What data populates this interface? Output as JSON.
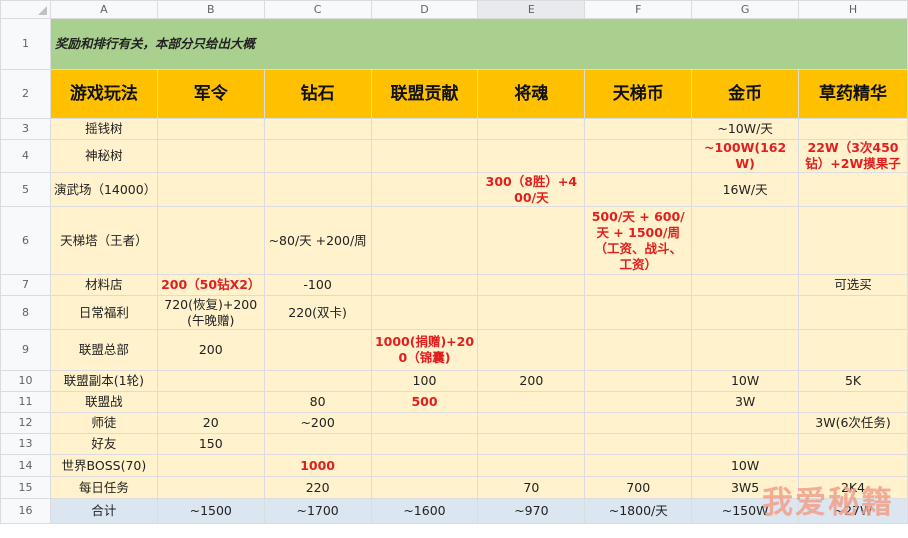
{
  "columns": [
    "A",
    "B",
    "C",
    "D",
    "E",
    "F",
    "G",
    "H"
  ],
  "row_numbers": [
    "1",
    "2",
    "3",
    "4",
    "5",
    "6",
    "7",
    "8",
    "9",
    "10",
    "11",
    "12",
    "13",
    "14",
    "15",
    "16"
  ],
  "note": "奖励和排行有关，本部分只给出大概",
  "header": [
    "游戏玩法",
    "军令",
    "钻石",
    "联盟贡献",
    "将魂",
    "天梯币",
    "金币",
    "草药精华"
  ],
  "rows": [
    [
      "摇钱树",
      "",
      "",
      "",
      "",
      "",
      "~10W/天",
      ""
    ],
    [
      "神秘树",
      "",
      "",
      "",
      "",
      "",
      "~100W(162W)",
      "22W（3次450钻）+2W摸果子"
    ],
    [
      "演武场（14000）",
      "",
      "",
      "",
      "300（8胜）+400/天",
      "",
      "16W/天",
      ""
    ],
    [
      "天梯塔（王者）",
      "",
      "~80/天 +200/周",
      "",
      "",
      "500/天 + 600/天 + 1500/周（工资、战斗、工资）",
      "",
      ""
    ],
    [
      "材料店",
      "200（50钻X2）",
      "-100",
      "",
      "",
      "",
      "",
      "可选买"
    ],
    [
      "日常福利",
      "720(恢复)+200(午晚赠)",
      "220(双卡)",
      "",
      "",
      "",
      "",
      ""
    ],
    [
      "联盟总部",
      "200",
      "",
      "1000(捐赠)+200（锦囊)",
      "",
      "",
      "",
      ""
    ],
    [
      "联盟副本(1轮)",
      "",
      "",
      "100",
      "200",
      "",
      "10W",
      "5K"
    ],
    [
      "联盟战",
      "",
      "80",
      "500",
      "",
      "",
      "3W",
      ""
    ],
    [
      "师徒",
      "20",
      "~200",
      "",
      "",
      "",
      "",
      "3W(6次任务)"
    ],
    [
      "好友",
      "150",
      "",
      "",
      "",
      "",
      "",
      ""
    ],
    [
      "世界BOSS(70)",
      "",
      "1000",
      "",
      "",
      "",
      "10W",
      ""
    ],
    [
      "每日任务",
      "",
      "220",
      "",
      "70",
      "700",
      "3W5",
      "2K4"
    ]
  ],
  "total": [
    "合计",
    "~1500",
    "~1700",
    "~1600",
    "~970",
    "~1800/天",
    "~150W",
    "~27W"
  ],
  "watermark": "我爱秘籍",
  "colors": {
    "note_bg": "#a9d08e",
    "header_bg": "#ffc000",
    "cell_bg": "#fff2cc",
    "total_bg": "#dce6f1",
    "highlight_text": "#e02020"
  }
}
